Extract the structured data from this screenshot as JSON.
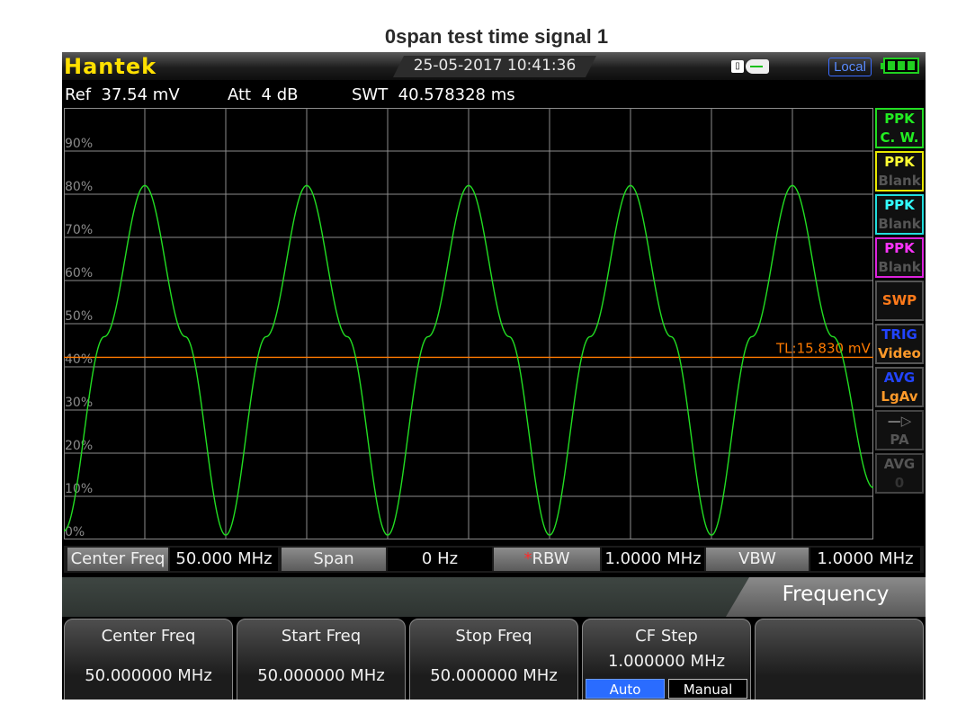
{
  "page_title": "0span test time signal 1",
  "topbar": {
    "brand": "Hantek",
    "datetime": "25-05-2017 10:41:36",
    "remote_state": "Local",
    "usb_icon": "usb-plug-icon",
    "battery_icon": "battery-full-icon",
    "battery_level": 1.0
  },
  "info": {
    "ref": "Ref  37.54 mV",
    "att": "Att  4 dB",
    "swt": "SWT  40.578328 ms"
  },
  "graph": {
    "y_labels": [
      "90%",
      "80%",
      "70%",
      "60%",
      "50%",
      "40%",
      "30%",
      "20%",
      "10%",
      "0%"
    ],
    "trigger_line_label": "TL:15.830 mV",
    "trigger_level_percent": 42.2,
    "trace_color": "#22dd22",
    "trigger_color": "#ff7a00",
    "grid_color": "#8c8c8c"
  },
  "chart_data": {
    "type": "line",
    "title": "",
    "xlabel": "",
    "ylabel": "",
    "ylim": [
      0,
      100
    ],
    "series": [
      {
        "color": "#22dd22",
        "x": [
          0,
          0.05,
          0.1,
          0.15,
          0.2,
          0.25,
          0.3,
          0.35,
          0.4,
          0.45,
          0.5,
          0.55,
          0.6,
          0.65,
          0.7,
          0.75,
          0.8,
          0.85,
          0.9,
          0.95,
          1.0
        ],
        "values": [
          2,
          47,
          82,
          47,
          1,
          47,
          82,
          47,
          1,
          47,
          82,
          47,
          1,
          47,
          82,
          47,
          1,
          47,
          82,
          47,
          12
        ]
      }
    ],
    "trigger_line": 42.2
  },
  "side_panel": [
    {
      "line1": "PPK",
      "line2": "C. W.",
      "color1": "#22ee22",
      "color2": "#22ee22",
      "border": "#22dd22"
    },
    {
      "line1": "PPK",
      "line2": "Blank",
      "color1": "#ffff33",
      "color2": "#555555",
      "border": "#e8e800"
    },
    {
      "line1": "PPK",
      "line2": "Blank",
      "color1": "#33ffff",
      "color2": "#555555",
      "border": "#22dddd"
    },
    {
      "line1": "PPK",
      "line2": "Blank",
      "color1": "#ff33ff",
      "color2": "#555555",
      "border": "#dd22dd"
    },
    {
      "line1": "SWP",
      "line2": "",
      "color1": "#ff7a1a",
      "color2": "#ff7a1a",
      "border": "#555555"
    },
    {
      "line1": "TRIG",
      "line2": "Video",
      "color1": "#2244ff",
      "color2": "#ff9a2a",
      "border": "#555555"
    },
    {
      "line1": "AVG",
      "line2": "LgAv",
      "color1": "#2244ff",
      "color2": "#ff9a2a",
      "border": "#555555"
    },
    {
      "line1": "—▷",
      "line2": "PA",
      "color1": "#777777",
      "color2": "#555555",
      "border": "#444444"
    },
    {
      "line1": "AVG",
      "line2": "0",
      "color1": "#555555",
      "color2": "#333333",
      "border": "#444444"
    }
  ],
  "param_bar": {
    "center_freq_label": "Center Freq",
    "center_freq_value": "50.000 MHz",
    "span_label": "Span",
    "span_value": "0 Hz",
    "rbw_marker": "*",
    "rbw_label": "RBW",
    "rbw_value": "1.0000 MHz",
    "vbw_label": "VBW",
    "vbw_value": "1.0000 MHz"
  },
  "menu": {
    "title": "Frequency"
  },
  "softkeys": [
    {
      "label": "Center Freq",
      "value": "50.000000 MHz"
    },
    {
      "label": "Start Freq",
      "value": "50.000000 MHz"
    },
    {
      "label": "Stop Freq",
      "value": "50.000000 MHz"
    },
    {
      "label": "CF Step",
      "value": "1.000000 MHz",
      "options": [
        "Auto",
        "Manual"
      ],
      "selected": "Auto"
    },
    {
      "label": "",
      "value": ""
    }
  ]
}
